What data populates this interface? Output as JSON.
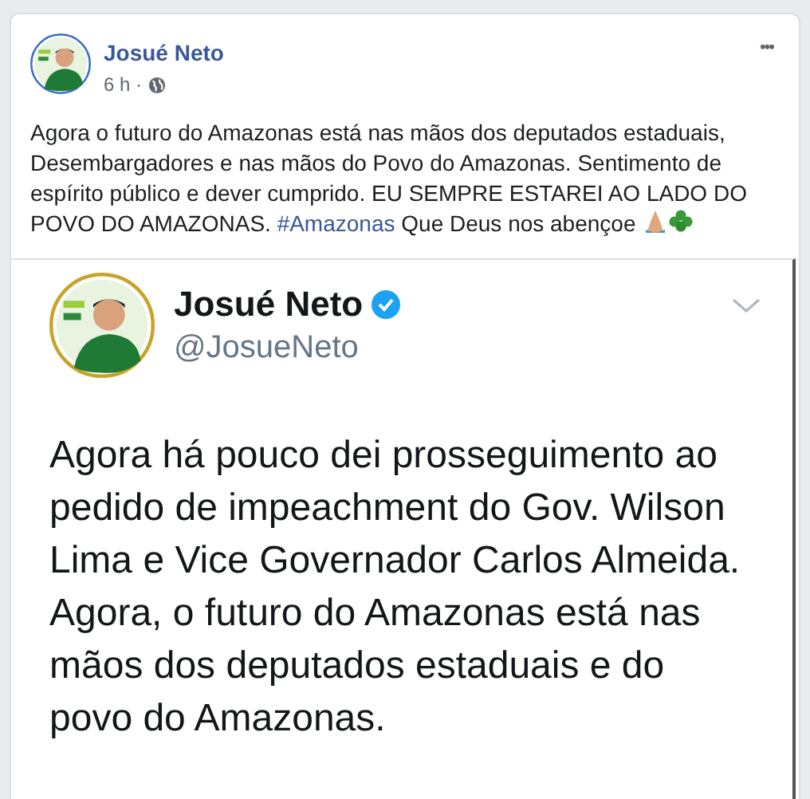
{
  "post": {
    "author": "Josué Neto",
    "time": "6 h ·",
    "more": "•••",
    "text_before": "Agora o futuro do Amazonas está nas mãos dos deputados estaduais, Desembargadores e nas mãos do Povo do Amazonas. Sentimento de espírito público e dever cumprido. EU SEMPRE ESTAREI AO LADO DO POVO DO AMAZONAS. ",
    "hashtag": "#Amazonas",
    "text_after": " Que Deus nos abençoe"
  },
  "tweet": {
    "author": "Josué Neto",
    "verified": true,
    "handle": "@JosueNeto",
    "text": "Agora há pouco dei prosseguimento ao pedido de impeachment do Gov. Wilson Lima e Vice Governador Carlos Almeida. Agora, o futuro do Amazonas está nas mãos dos deputados estaduais e do povo do Amazonas."
  }
}
